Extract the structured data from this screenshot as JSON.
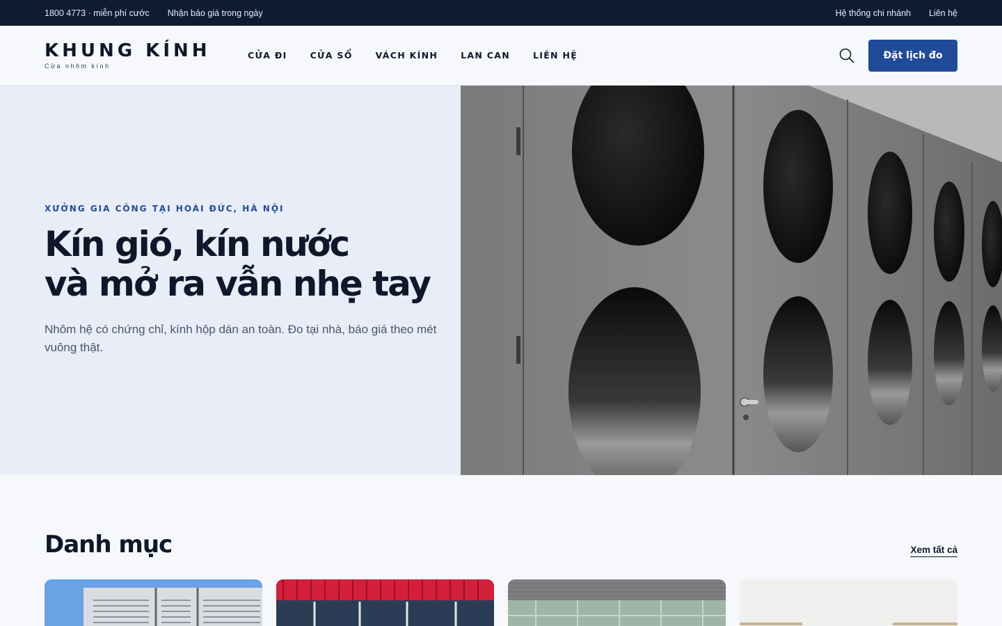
{
  "topbar": {
    "hotline": "1800 4773 · miễn phí cước",
    "quote": "Nhận báo giá trong ngày",
    "branches": "Hệ thống chi nhánh",
    "contact": "Liên hệ"
  },
  "brand": {
    "name": "KHUNG KÍNH",
    "tagline": "Cửa nhôm kính"
  },
  "nav": {
    "items": [
      "CỬA ĐI",
      "CỬA SỔ",
      "VÁCH KÍNH",
      "LAN CAN",
      "LIÊN HỆ"
    ]
  },
  "header": {
    "cta_label": "Đặt lịch đo"
  },
  "hero": {
    "eyebrow": "XƯỞNG GIA CÔNG TẠI HOÀI ĐỨC, HÀ NỘI",
    "title_line1": "Kín gió, kín nước",
    "title_line2": "và mở ra vẫn nhẹ tay",
    "description": "Nhôm hệ có chứng chỉ, kính hộp dán an toàn. Đo tại nhà, báo giá theo mét vuông thật."
  },
  "categories": {
    "title": "Danh mục",
    "see_all": "Xem tất cả"
  },
  "colors": {
    "topbar_bg": "#0f1b33",
    "accent": "#1f4b99",
    "hero_bg": "#e8edf8"
  },
  "icons": {
    "search": "search-icon"
  }
}
